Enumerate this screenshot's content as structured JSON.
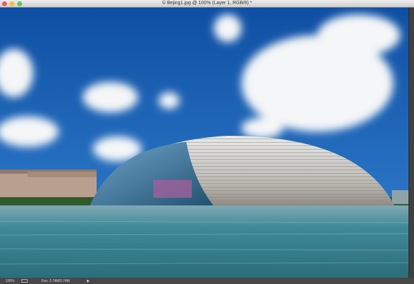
{
  "window": {
    "title": "© Bejing1.jpg @ 100% (Layer 1, RGB/8) *"
  },
  "status": {
    "zoom": "100%",
    "doc_info": "Doc: 2.74M/2.74M",
    "arrow": "▶"
  },
  "colors": {
    "close": "#ee5b55",
    "minimize": "#f5bd3b",
    "zoom": "#5fc453",
    "sky": "#1e5fae",
    "water": "#3b8a97"
  }
}
